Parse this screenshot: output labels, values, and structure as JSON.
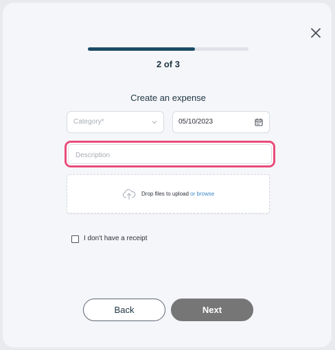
{
  "progress": {
    "fraction": 0.667,
    "step_label": "2 of 3",
    "fill_color": "#1b4a66"
  },
  "form": {
    "title": "Create an expense",
    "category": {
      "placeholder": "Category*",
      "icon": "chevron-down-icon"
    },
    "date": {
      "value": "05/10/2023",
      "icon": "calendar-icon"
    },
    "description": {
      "placeholder": "Description",
      "value": "",
      "highlight_color": "#ea4b7a"
    },
    "upload": {
      "icon": "cloud-upload-icon",
      "text": "Drop files to upload",
      "browse_text": "or browse"
    },
    "no_receipt": {
      "label": "I don't have a receipt",
      "checked": false
    }
  },
  "actions": {
    "back_label": "Back",
    "next_label": "Next"
  },
  "close_icon": "close-icon"
}
